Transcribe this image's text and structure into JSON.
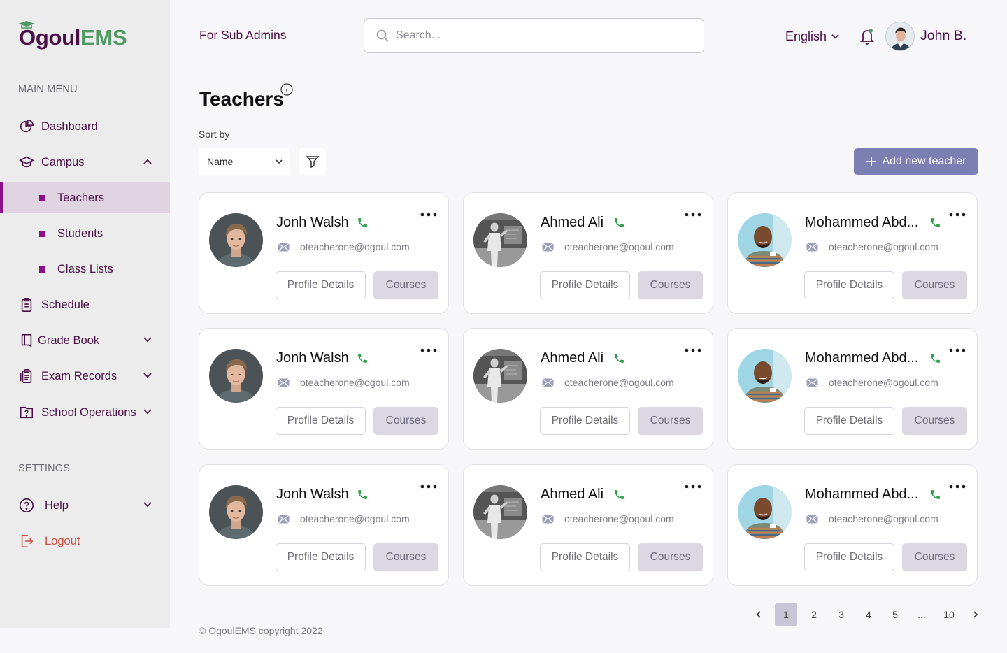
{
  "logo": {
    "part1": "Ogoul",
    "part2": "EMS"
  },
  "sidebar": {
    "main_heading": "MAIN MENU",
    "settings_heading": "SETTINGS",
    "items": {
      "dashboard": "Dashboard",
      "campus": "Campus",
      "teachers": "Teachers",
      "students": "Students",
      "class_lists": "Class Lists",
      "schedule": "Schedule",
      "grade_book": "Grade Book",
      "exam_records": "Exam Records",
      "school_operations": "School Operations",
      "help": "Help",
      "logout": "Logout"
    },
    "active_item": "Teachers",
    "colors": {
      "brand": "#4a0f46",
      "accent": "#8a0f88",
      "logout": "#d04a3e",
      "ems_green": "#4f9a62"
    }
  },
  "header": {
    "section_title": "For Sub Admins",
    "search_placeholder": "Search...",
    "language": "English",
    "user_name": "John B."
  },
  "page": {
    "title": "Teachers",
    "sort_label": "Sort by",
    "sort_value": "Name",
    "add_button": "Add new teacher"
  },
  "teachers": [
    {
      "name": "Jonh Walsh",
      "email": "oteacherone@ogoul.com",
      "profile_label": "Profile Details",
      "courses_label": "Courses",
      "avatar": "young-man-photo"
    },
    {
      "name": "Ahmed Ali",
      "email": "oteacherone@ogoul.com",
      "profile_label": "Profile Details",
      "courses_label": "Courses",
      "avatar": "teacher-at-board-bw-photo"
    },
    {
      "name": "Mohammed Abd...",
      "email": "oteacherone@ogoul.com",
      "profile_label": "Profile Details",
      "courses_label": "Courses",
      "avatar": "smiling-man-striped-shirt-photo"
    },
    {
      "name": "Jonh Walsh",
      "email": "oteacherone@ogoul.com",
      "profile_label": "Profile Details",
      "courses_label": "Courses",
      "avatar": "young-man-photo"
    },
    {
      "name": "Ahmed Ali",
      "email": "oteacherone@ogoul.com",
      "profile_label": "Profile Details",
      "courses_label": "Courses",
      "avatar": "teacher-at-board-bw-photo"
    },
    {
      "name": "Mohammed Abd...",
      "email": "oteacherone@ogoul.com",
      "profile_label": "Profile Details",
      "courses_label": "Courses",
      "avatar": "smiling-man-striped-shirt-photo"
    },
    {
      "name": "Jonh Walsh",
      "email": "oteacherone@ogoul.com",
      "profile_label": "Profile Details",
      "courses_label": "Courses",
      "avatar": "young-man-photo"
    },
    {
      "name": "Ahmed Ali",
      "email": "oteacherone@ogoul.com",
      "profile_label": "Profile Details",
      "courses_label": "Courses",
      "avatar": "teacher-at-board-bw-photo"
    },
    {
      "name": "Mohammed Abd...",
      "email": "oteacherone@ogoul.com",
      "profile_label": "Profile Details",
      "courses_label": "Courses",
      "avatar": "smiling-man-striped-shirt-photo"
    }
  ],
  "pagination": {
    "pages": [
      "1",
      "2",
      "3",
      "4",
      "5",
      "...",
      "10"
    ],
    "current": "1"
  },
  "footer": {
    "copyright": "© OgoulEMS copyright 2022"
  },
  "colors": {
    "primary_button": "#7b7fb2",
    "phone_green": "#2e9e4a",
    "courses_button_bg": "#dcd8e3",
    "page_bg": "#f7f6f9"
  }
}
